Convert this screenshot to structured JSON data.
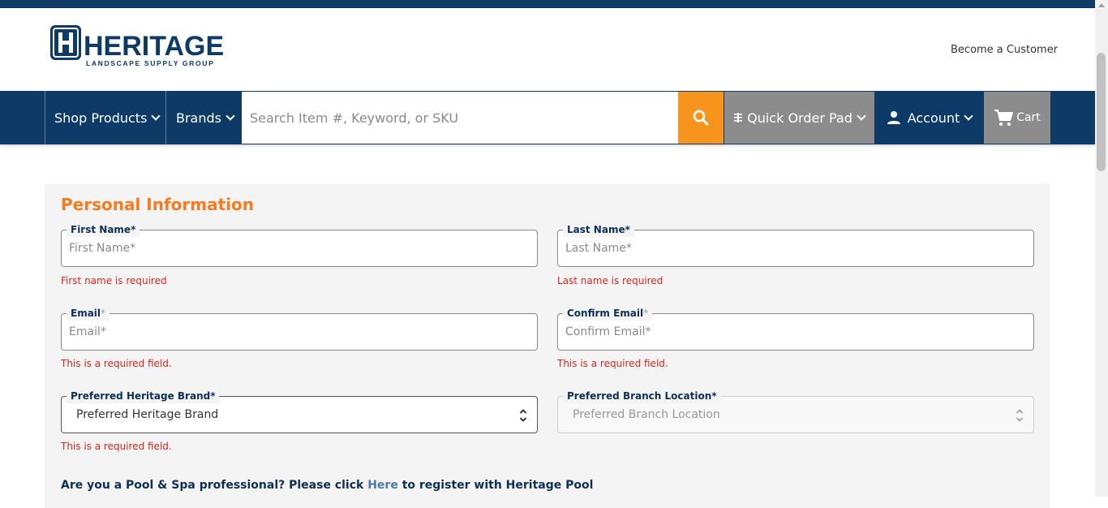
{
  "header": {
    "logo_text": "HERITAGE",
    "logo_sub": "LANDSCAPE SUPPLY GROUP",
    "become_customer": "Become a Customer"
  },
  "nav": {
    "shop_products": "Shop Products",
    "brands": "Brands",
    "search_placeholder": "Search Item #, Keyword, or SKU",
    "quick_order_pad": "Quick Order Pad",
    "account": "Account",
    "cart": "Cart"
  },
  "colors": {
    "navy": "#0d3a66",
    "orange": "#f47b20",
    "search_orange": "#f7941d",
    "error_red": "#d9261c"
  },
  "form": {
    "section_title": "Personal Information",
    "first_name": {
      "label": "First Name*",
      "placeholder": "First Name*",
      "error": "First name is required"
    },
    "last_name": {
      "label": "Last Name*",
      "placeholder": "Last Name*",
      "error": "Last name is required"
    },
    "email": {
      "label": "Email",
      "asterisk": "*",
      "placeholder": "Email*",
      "error": "This is a required field."
    },
    "confirm_email": {
      "label": "Confirm Email",
      "asterisk": "*",
      "placeholder": "Confirm Email*",
      "error": "This is a required field."
    },
    "brand": {
      "label": "Preferred Heritage Brand*",
      "value": "Preferred Heritage Brand",
      "error": "This is a required field."
    },
    "branch": {
      "label": "Preferred Branch Location*",
      "value": "Preferred Branch Location"
    },
    "pool": {
      "prefix": "Are you a Pool & Spa professional? Please click ",
      "link": "Here",
      "suffix": " to register with Heritage Pool"
    }
  }
}
